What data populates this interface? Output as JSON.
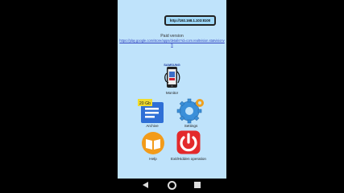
{
  "server": {
    "url_button": "http://192.168.1.103:8100"
  },
  "paid": {
    "title": "Paid version",
    "link": "https://play.google.com/store/apps/details?id=com.realtvision.statvisionv5"
  },
  "tiles": {
    "monitor": {
      "label": "Monitor",
      "brand": "SAMSUNG"
    },
    "archive": {
      "label": "Archive",
      "badge": "20 Gb"
    },
    "settings": {
      "label": "Settings"
    },
    "help": {
      "label": "Help"
    },
    "exit": {
      "label": "Exit/Hidden operation"
    }
  },
  "icons": {
    "monitor": "usb-phone-icon",
    "archive": "document-folder-icon",
    "settings": "gears-icon",
    "help": "open-book-icon",
    "exit": "power-icon",
    "nav": [
      "back-icon",
      "home-icon",
      "recents-icon"
    ]
  },
  "colors": {
    "screen_bg": "#bfe3fb",
    "url_button_bg": "#9fd8f8",
    "link": "#2d3fbf",
    "archive_blue": "#2f6fd6",
    "badge_yellow": "#f1dc2e",
    "settings_blue": "#3a8fd9",
    "help_orange": "#f29b1a",
    "exit_red": "#e3292b"
  }
}
